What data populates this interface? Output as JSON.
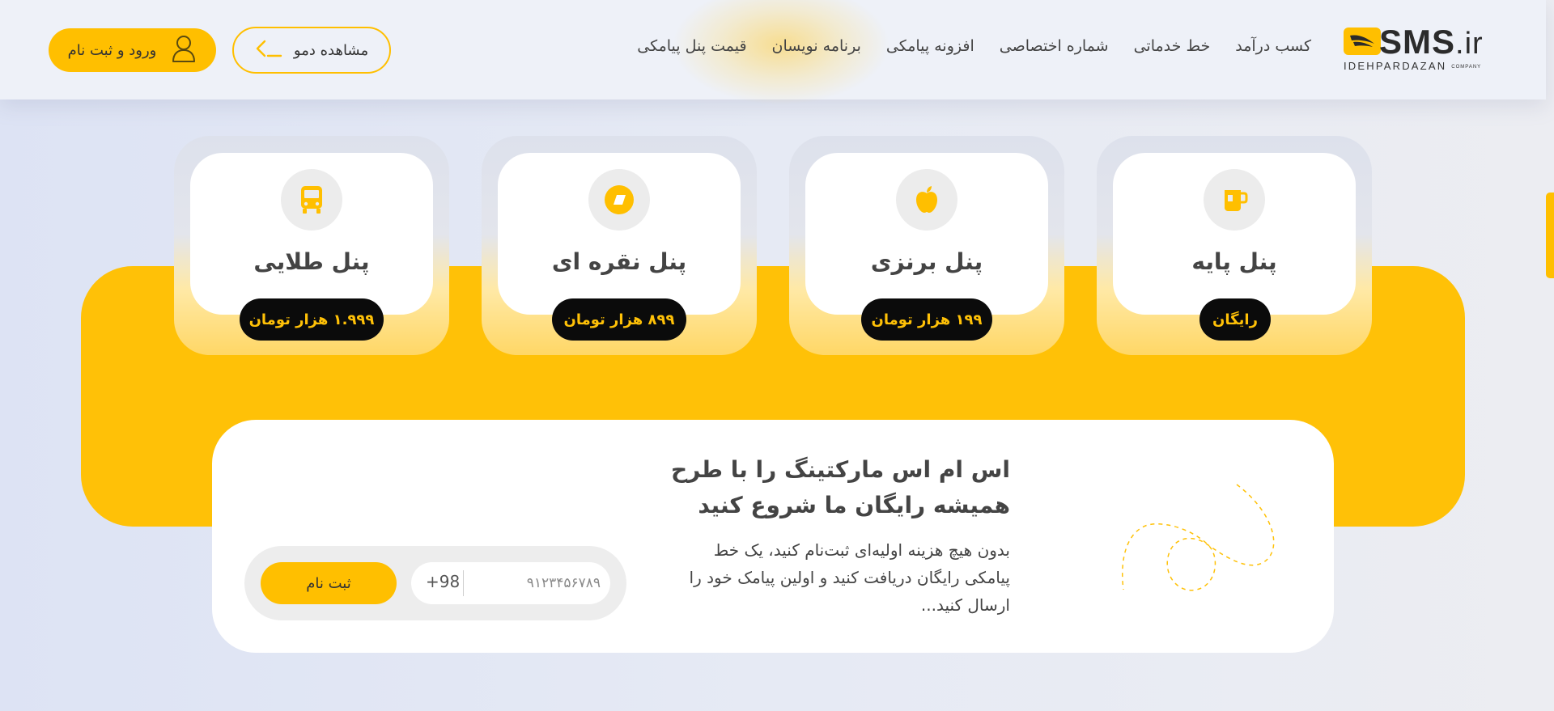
{
  "header": {
    "logo": {
      "brand": "SMS",
      "tld": ".ir",
      "company": "IDEHPARDAZAN",
      "company_suffix": "COMPANY"
    },
    "nav": [
      "قیمت پنل پیامکی",
      "برنامه نویسان",
      "افزونه پیامکی",
      "شماره اختصاصی",
      "خط خدماتی",
      "کسب درآمد"
    ],
    "demo_button": "مشاهده دمو",
    "login_button": "ورود و ثبت نام"
  },
  "plans": [
    {
      "title": "پنل پایه",
      "price": "رایگان",
      "icon": "mug-icon"
    },
    {
      "title": "پنل برنزی",
      "price": "۱۹۹ هزار تومان",
      "icon": "apple-icon"
    },
    {
      "title": "پنل نقره ای",
      "price": "۸۹۹ هزار تومان",
      "icon": "ticket-icon"
    },
    {
      "title": "پنل طلایی",
      "price": "۱.۹۹۹ هزار تومان",
      "icon": "bus-icon"
    }
  ],
  "cta": {
    "title_line1": "اس ام اس مارکتینگ را با طرح",
    "title_line2": "همیشه رایگان ما شروع کنید",
    "description": "بدون هیچ هزینه اولیه‌ای ثبت‌نام کنید، یک خط پیامکی رایگان دریافت کنید و اولین پیامک خود را ارسال کنید...",
    "phone_prefix": "+98",
    "phone_placeholder": "۹۱۲۳۴۵۶۷۸۹",
    "register_button": "ثبت نام"
  },
  "colors": {
    "accent": "#ffc107",
    "dark": "#0b0b0b"
  }
}
